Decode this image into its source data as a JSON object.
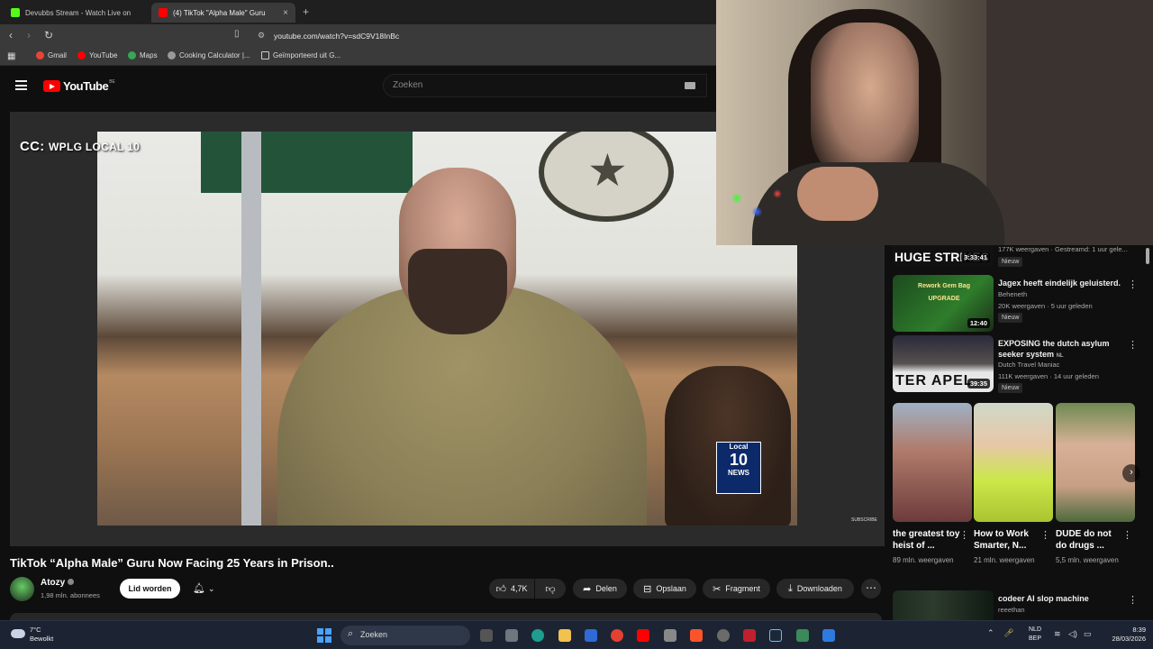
{
  "browser": {
    "tabs": [
      {
        "label": "Devubbs Stream - Watch Live on",
        "favicon_color": "#53fc18"
      },
      {
        "label": "(4) TikTok \"Alpha Male\" Guru",
        "favicon_color": "#ff0000"
      }
    ],
    "tab_close": "×",
    "new_tab": "+",
    "url": "youtube.com/watch?v=sdC9V18InBc",
    "bookmarks": [
      "Gmail",
      "YouTube",
      "Maps",
      "Cooking Calculator |...",
      "Geïmporteerd uit G..."
    ]
  },
  "youtube": {
    "logo_text": "YouTube",
    "country_code": "BE",
    "search_placeholder": "Zoeken"
  },
  "video": {
    "overlay_cc": "CC:",
    "overlay_source": "WPLG LOCAL 10",
    "station_logo_top": "Local",
    "station_logo_num": "10",
    "station_logo_bottom": "NEWS",
    "subscribe_watermark": "SUBSCRIBE",
    "title": "TikTok “Alpha Male” Guru Now Facing 25 Years in Prison..",
    "channel": "Atozy",
    "subscribers": "1,98 mln. abonnees",
    "join_label": "Lid worden",
    "likes": "4,7K",
    "actions": {
      "share": "Delen",
      "save": "Opslaan",
      "clip": "Fragment",
      "download": "Downloaden"
    }
  },
  "sidebar": {
    "top_partial": {
      "thumb_text": "HUGE STRIKES",
      "duration": "3:33:41",
      "meta": "177K weergaven · Gestreamd: 1 uur gele...",
      "badge": "Nieuw"
    },
    "recommendations": [
      {
        "title": "Jagex heeft eindelijk geluisterd.",
        "channel": "Beheneth",
        "meta": "20K weergaven · 5 uur geleden",
        "badge": "Nieuw",
        "duration": "12:40",
        "thumb_text": "Rework  Gem Bag  UPGRADE"
      },
      {
        "title": "EXPOSING the dutch asylum seeker system",
        "title_tag": "NL",
        "channel": "Dutch Travel Maniac",
        "meta": "111K weergaven · 14 uur geleden",
        "badge": "Nieuw",
        "duration": "39:35",
        "thumb_text": "TER APEL"
      }
    ],
    "shorts": [
      {
        "title": "the greatest toy heist of ...",
        "views": "89 mln. weergaven"
      },
      {
        "title": "How to Work Smarter, N...",
        "views": "21 mln. weergaven"
      },
      {
        "title": "DUDE do not do drugs ...",
        "views": "5,5 mln. weergaven"
      }
    ],
    "bottom_partial": {
      "title": "codeer AI slop machine",
      "channel": "reeethan"
    }
  },
  "taskbar": {
    "temperature": "7°C",
    "weather": "Bewolkt",
    "search_label": "Zoeken",
    "lang_top": "NLD",
    "lang_bottom": "BEP",
    "time": "8:39",
    "date": "28/03/2026"
  }
}
